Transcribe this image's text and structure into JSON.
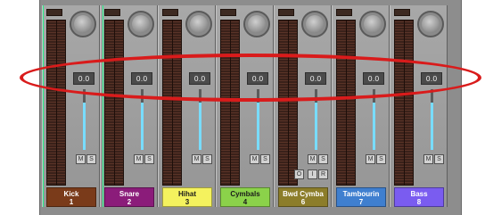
{
  "mixer": {
    "channels": [
      {
        "name": "Kick",
        "number": "1",
        "volume": "0.0",
        "color": "#7a3b1a",
        "text_color": "#ffffff",
        "fader_level": 0.78
      },
      {
        "name": "Snare",
        "number": "2",
        "volume": "0.0",
        "color": "#8b1c7a",
        "text_color": "#ffffff",
        "fader_level": 0.78
      },
      {
        "name": "Hihat",
        "number": "3",
        "volume": "0.0",
        "color": "#f4f25e",
        "text_color": "#1a1a1a",
        "fader_level": 0.78
      },
      {
        "name": "Cymbals",
        "number": "4",
        "volume": "0.0",
        "color": "#8bd24a",
        "text_color": "#1a1a1a",
        "fader_level": 0.78
      },
      {
        "name": "Bwd Cymba",
        "number": "6",
        "volume": "0.0",
        "color": "#8c7d2a",
        "text_color": "#ffffff",
        "fader_level": 0.78
      },
      {
        "name": "Tambourin",
        "number": "7",
        "volume": "0.0",
        "color": "#3f7fcf",
        "text_color": "#ffffff",
        "fader_level": 0.78
      },
      {
        "name": "Bass",
        "number": "8",
        "volume": "0.0",
        "color": "#7a5cf0",
        "text_color": "#ffffff",
        "fader_level": 0.78
      }
    ],
    "mute_label": "M",
    "solo_label": "S",
    "extra_buttons": {
      "channel_index": 4,
      "labels": [
        "O",
        "I",
        "R"
      ]
    }
  },
  "colors": {
    "fader_fill": "#78dcff",
    "highlight_ring": "#d91b1b",
    "selected_line": "#28f08a"
  }
}
